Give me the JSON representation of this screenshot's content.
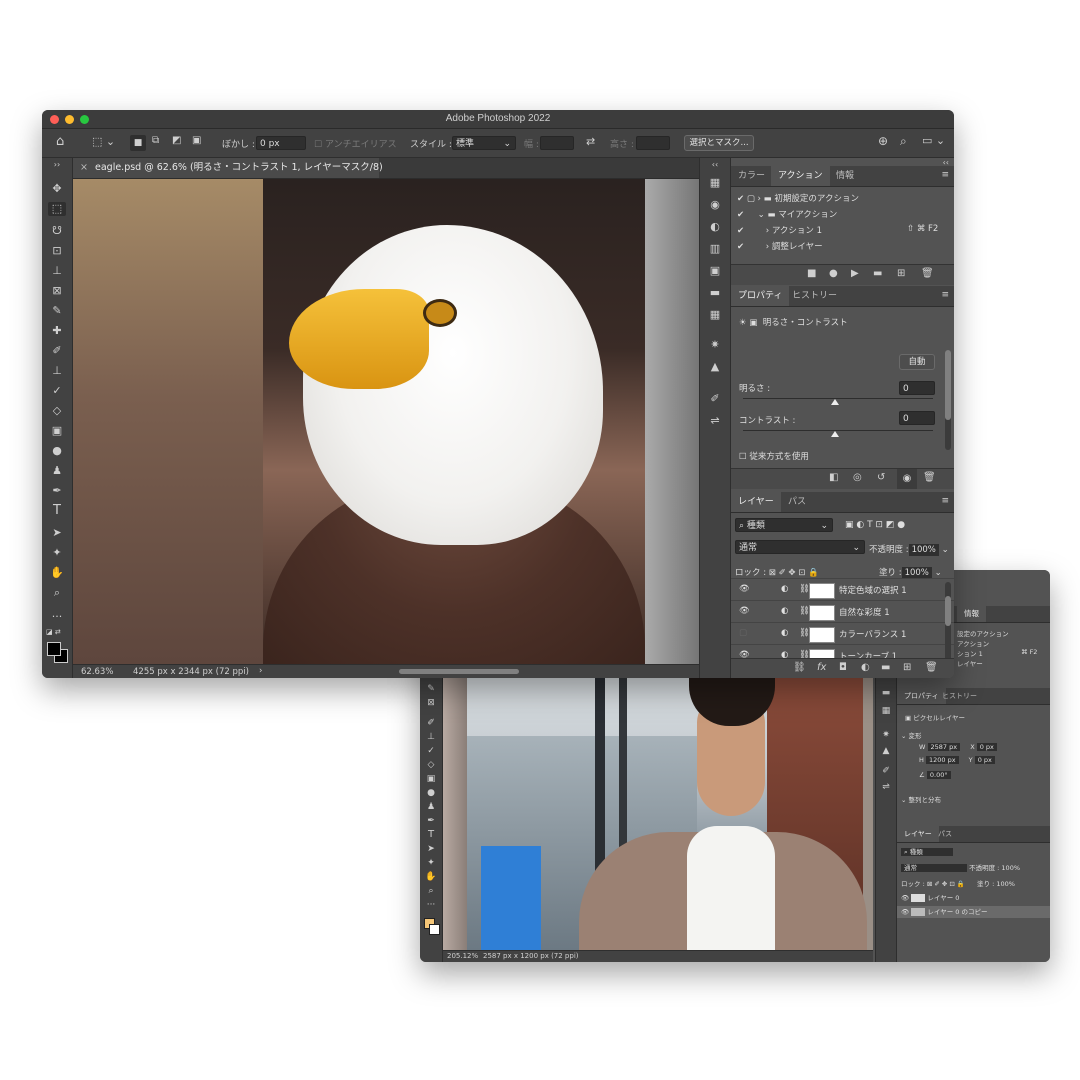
{
  "win1": {
    "title": "Adobe Photoshop 2022",
    "options": {
      "feather_label": "ぼかし :",
      "feather_value": "0 px",
      "antialias_label": "アンチエイリアス",
      "style_label": "スタイル :",
      "style_value": "標準",
      "width_label": "幅 :",
      "height_label": "高さ :",
      "select_mask_button": "選択とマスク..."
    },
    "doc_tab": "eagle.psd @ 62.6% (明るさ・コントラスト 1, レイヤーマスク/8)",
    "status": {
      "zoom": "62.63%",
      "size": "4255 px x 2344 px (72 ppi)"
    },
    "actions_panel": {
      "tabs": [
        "カラー",
        "アクション",
        "情報"
      ],
      "rows": [
        "初期設定のアクション",
        "マイアクション",
        "アクション 1",
        "調整レイヤー"
      ],
      "shortcut": "⇧ ⌘ F2"
    },
    "properties_panel": {
      "tabs": [
        "プロパティ",
        "ヒストリー"
      ],
      "header": "明るさ・コントラスト",
      "auto_button": "自動",
      "brightness_label": "明るさ :",
      "brightness_value": "0",
      "contrast_label": "コントラスト :",
      "contrast_value": "0",
      "legacy_label": "従来方式を使用"
    },
    "layers_panel": {
      "tabs": [
        "レイヤー",
        "パス"
      ],
      "filter_value": "種類",
      "blend_mode": "通常",
      "opacity_label": "不透明度 :",
      "opacity_value": "100%",
      "lock_label": "ロック :",
      "fill_label": "塗り :",
      "fill_value": "100%",
      "layers": [
        "特定色域の選択 1",
        "自然な彩度 1",
        "カラーバランス 1",
        "トーンカーブ 1"
      ]
    }
  },
  "win2": {
    "status": {
      "zoom": "205.12%",
      "size": "2587 px x 1200 px (72 ppi)"
    },
    "actions_panel": {
      "tabs": [
        "情報"
      ],
      "rows": [
        "設定のアクション",
        "アクション",
        "ション 1",
        "レイヤー"
      ],
      "shortcut": "⌘ F2"
    },
    "properties_panel": {
      "tabs": [
        "プロパティ",
        "ヒストリー"
      ],
      "header": "ピクセルレイヤー",
      "transform_label": "変形",
      "w_label": "W",
      "w_value": "2587 px",
      "h_label": "H",
      "h_value": "1200 px",
      "x_label": "X",
      "x_value": "0 px",
      "y_label": "Y",
      "y_value": "0 px",
      "angle_value": "0.00°",
      "align_label": "整列と分布"
    },
    "layers_panel": {
      "tabs": [
        "レイヤー",
        "パス"
      ],
      "filter_value": "種類",
      "blend_mode": "通常",
      "opacity_label": "不透明度 :",
      "opacity_value": "100%",
      "lock_label": "ロック :",
      "fill_label": "塗り :",
      "fill_value": "100%",
      "layers": [
        "レイヤー 0",
        "レイヤー 0 のコピー"
      ]
    }
  },
  "colors": {
    "traffic_red": "#ff5f57",
    "traffic_yellow": "#febc2e",
    "traffic_green": "#28c840",
    "panel_bg": "#535353",
    "dark_bg": "#424242"
  }
}
